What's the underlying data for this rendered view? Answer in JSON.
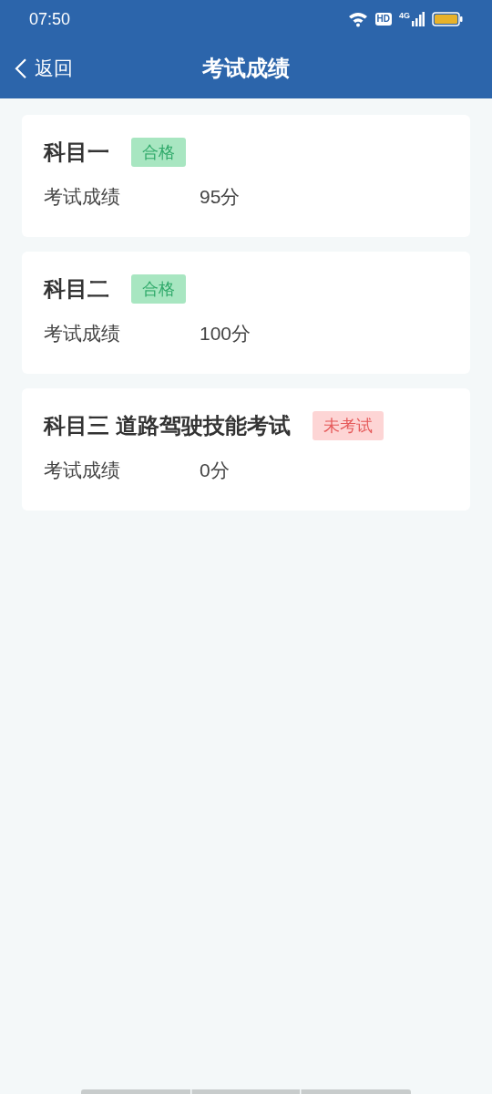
{
  "status_bar": {
    "time": "07:50",
    "badge": "HD",
    "network": "4G"
  },
  "header": {
    "back": "返回",
    "title": "考试成绩"
  },
  "subjects": [
    {
      "name": "科目一",
      "kind": "passed",
      "badge": "合格",
      "label": "考试成绩",
      "score": "95分"
    },
    {
      "name": "科目二",
      "kind": "passed",
      "badge": "合格",
      "label": "考试成绩",
      "score": "100分"
    },
    {
      "name": "科目三 道路驾驶技能考试",
      "kind": "pending",
      "badge": "未考试",
      "label": "考试成绩",
      "score": "0分"
    }
  ]
}
